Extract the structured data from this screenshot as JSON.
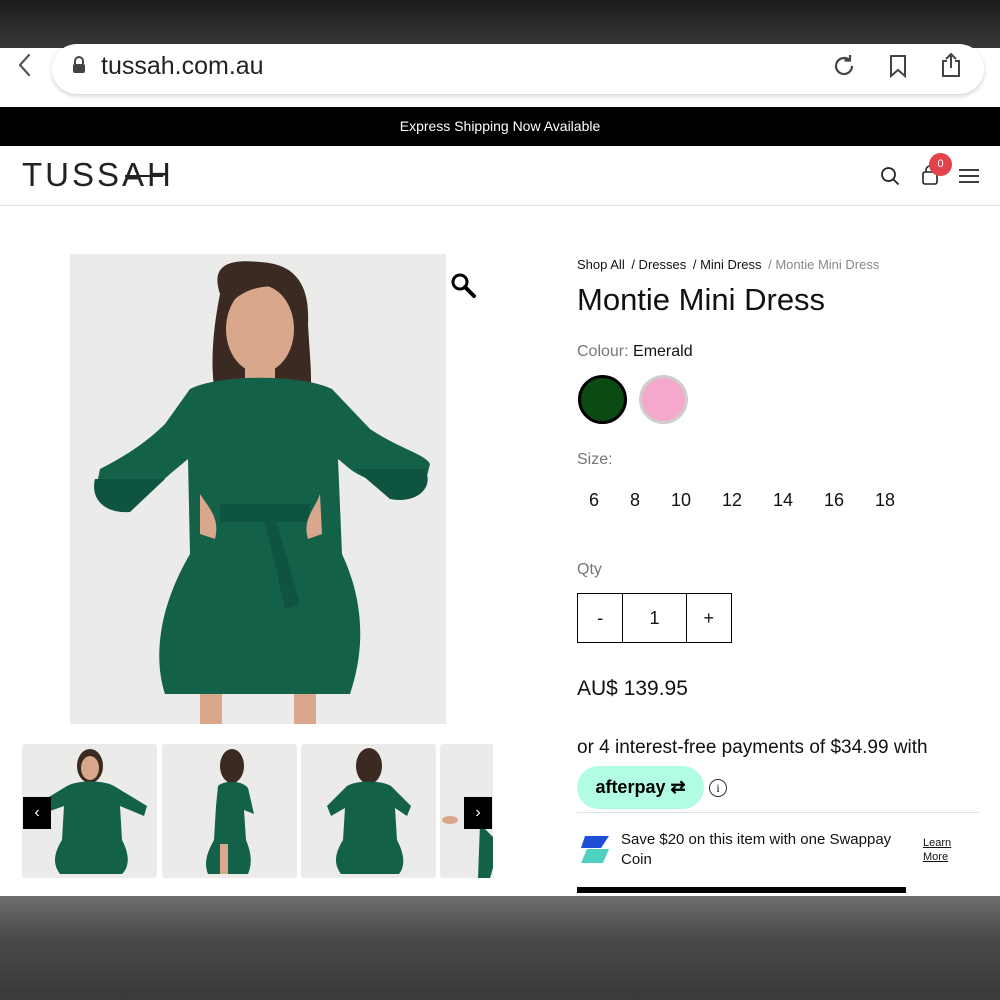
{
  "browser": {
    "url": "tussah.com.au"
  },
  "promo": {
    "text": "Express Shipping Now Available"
  },
  "header": {
    "logo": "TUSSAH",
    "cart_count": "0"
  },
  "gallery": {
    "prev_label": "‹",
    "next_label": "›"
  },
  "breadcrumb": {
    "items": [
      "Shop All",
      "/ Dresses",
      "/ Mini Dress",
      "/ Montie Mini Dress"
    ]
  },
  "product": {
    "title": "Montie Mini Dress",
    "colour_label": "Colour:",
    "colour_value": "Emerald",
    "colours": [
      {
        "name": "Emerald",
        "hex": "#0b4a12"
      },
      {
        "name": "Pink",
        "hex": "#f4a8cb"
      }
    ],
    "size_label": "Size:",
    "sizes": [
      "6",
      "8",
      "10",
      "12",
      "14",
      "16",
      "18"
    ],
    "qty_label": "Qty",
    "qty_minus": "-",
    "qty_value": "1",
    "qty_plus": "+",
    "price": "AU$ 139.95"
  },
  "payments": {
    "installments": "or 4 interest-free payments of $34.99 with",
    "afterpay": "afterpay",
    "info": "i",
    "swappay_text": "Save $20 on this item with one Swappay Coin",
    "learn_more": "Learn More"
  },
  "colors": {
    "promo_bg": "#000000",
    "badge": "#e2424b",
    "afterpay_mint": "#b2fce4",
    "dress_green": "#14614a"
  }
}
